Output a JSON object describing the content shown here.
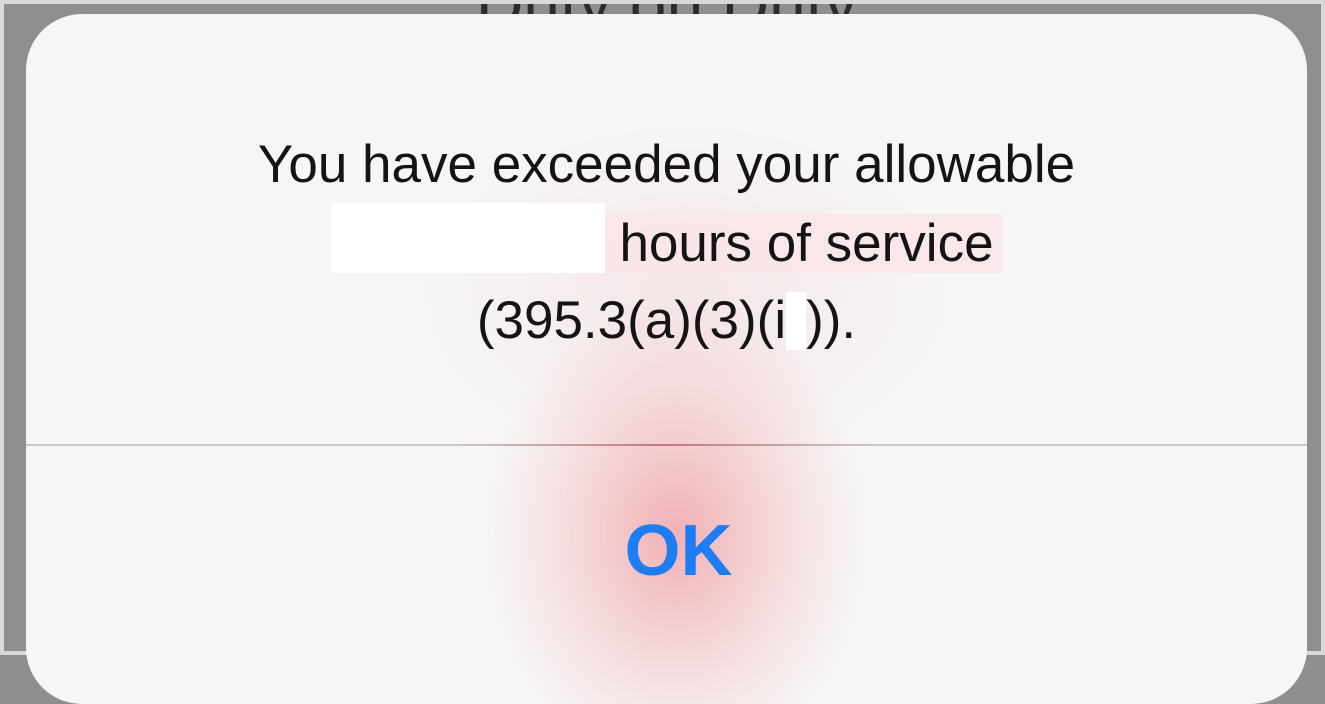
{
  "backdrop": {
    "title": "Duty on Duty"
  },
  "alert": {
    "message_line1": "You have exceeded your allowable",
    "message_line2": "hours of service",
    "message_line3_a": "(395.3(a)(3)(i",
    "message_line3_b": ")).",
    "ok_label": "OK"
  },
  "colors": {
    "accent": "#1d7df2",
    "alert_background": "#f6f6f6",
    "backdrop": "#8f8f8f"
  }
}
